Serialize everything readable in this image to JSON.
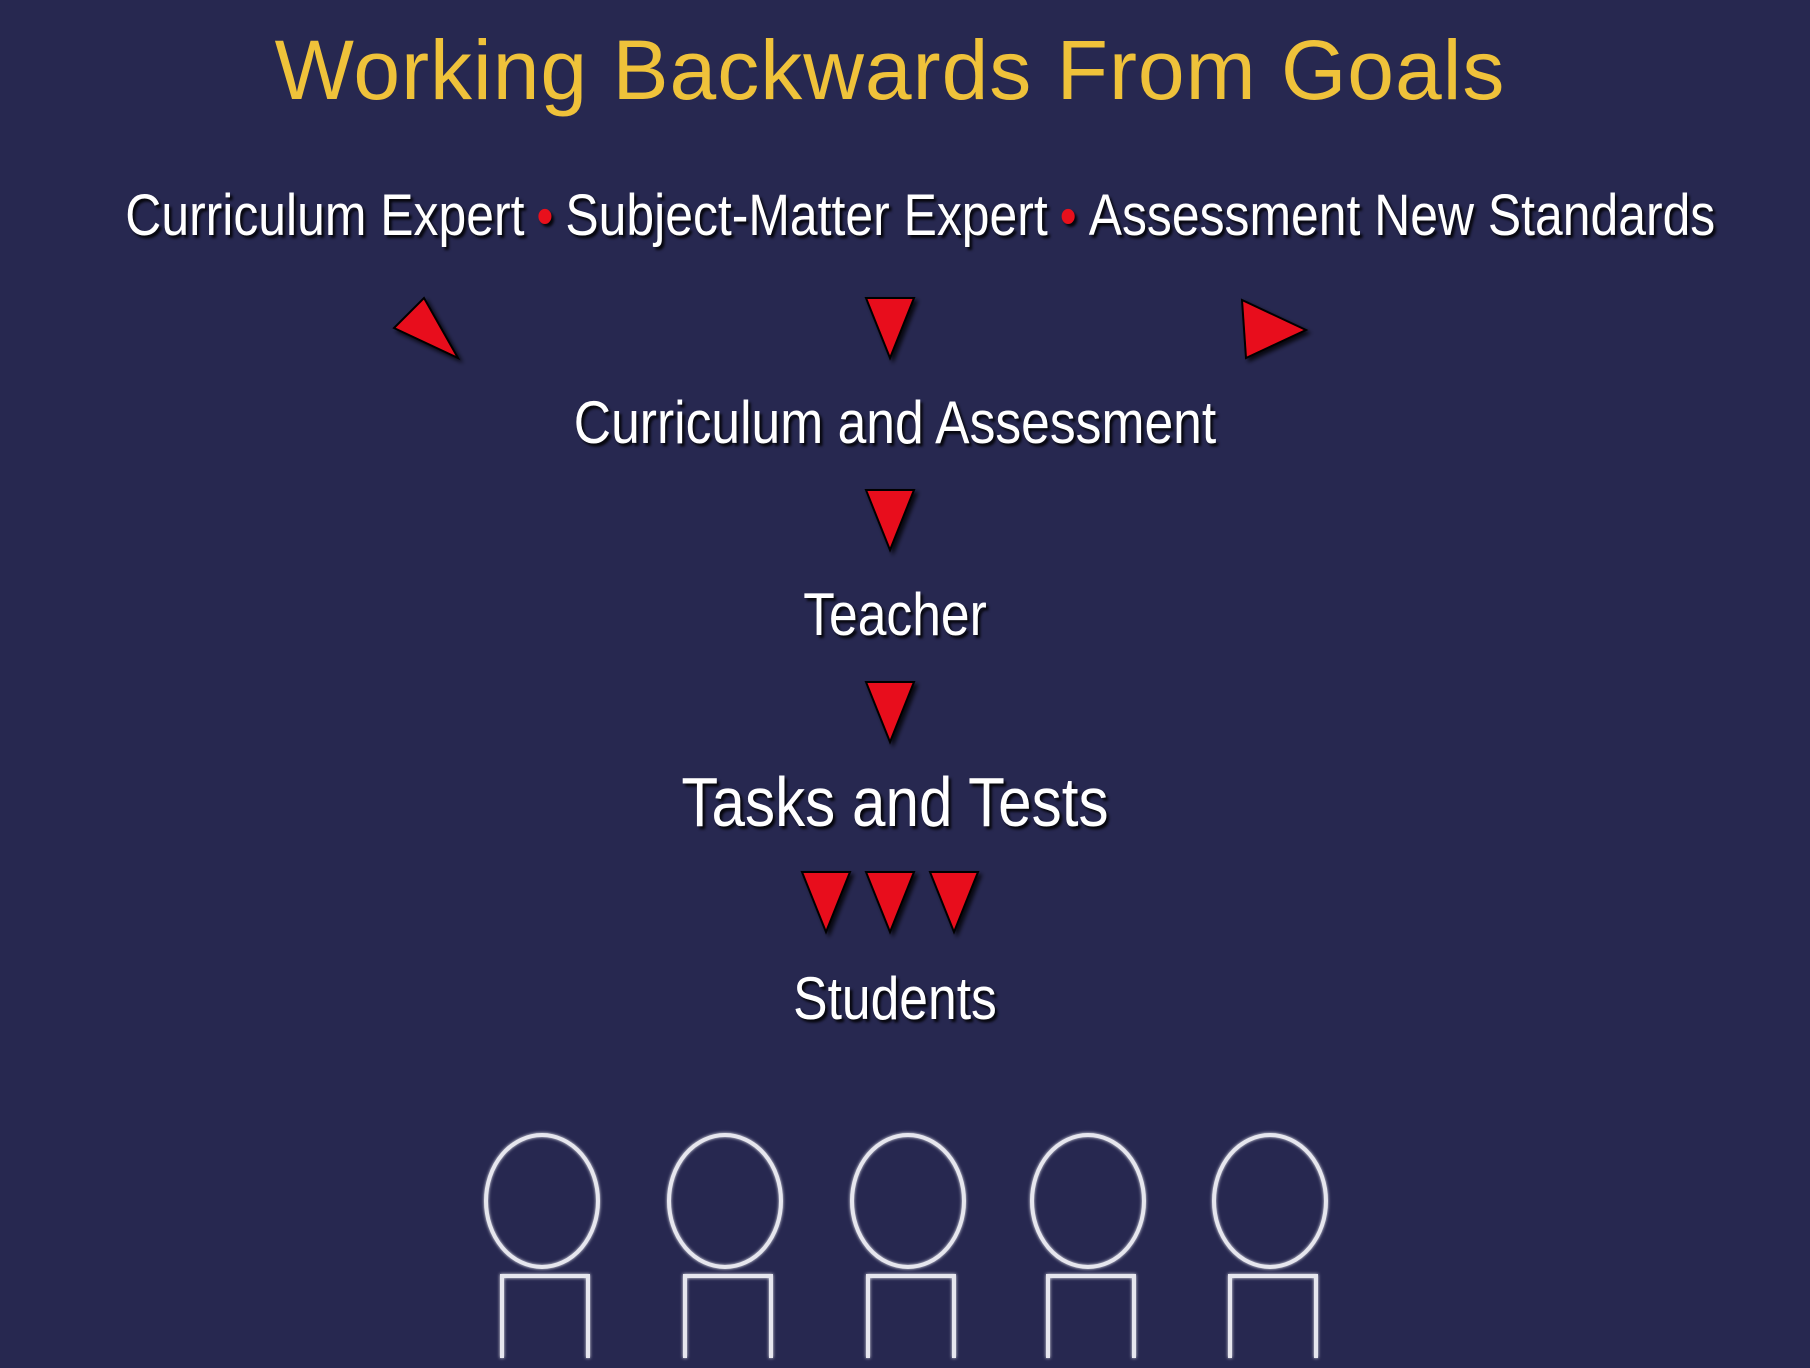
{
  "title": "Working Backwards From Goals",
  "sources": [
    "Curriculum Expert",
    "Subject-Matter Expert",
    "Assessment New Standards"
  ],
  "separator": "•",
  "flow": [
    "Curriculum and Assessment",
    "Teacher",
    "Tasks and Tests",
    "Students"
  ],
  "colors": {
    "background": "#272850",
    "title": "#efc23a",
    "text": "#ffffff",
    "arrow": "#e8101c",
    "separator": "#e8101c",
    "student_outline": "#e6e6ee"
  },
  "student_count": 5
}
